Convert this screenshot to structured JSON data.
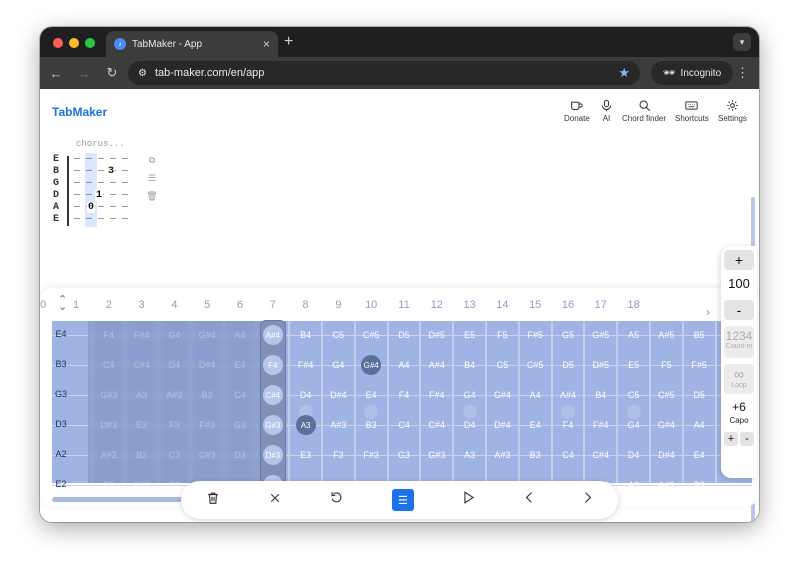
{
  "browser": {
    "tab_title": "TabMaker - App",
    "url": "tab-maker.com/en/app",
    "incognito_label": "Incognito",
    "new_tab": "+",
    "close": "×"
  },
  "header": {
    "brand": "TabMaker",
    "buttons": [
      {
        "label": "Donate",
        "icon": "coffee-icon"
      },
      {
        "label": "AI",
        "icon": "microphone-icon"
      },
      {
        "label": "Chord finder",
        "icon": "search-icon"
      },
      {
        "label": "Shortcuts",
        "icon": "keyboard-icon"
      },
      {
        "label": "Settings",
        "icon": "gear-icon"
      }
    ]
  },
  "tab_sheet": {
    "section_label": "chorus...",
    "strings": [
      "E",
      "B",
      "G",
      "D",
      "A",
      "E"
    ],
    "lines": [
      "— — — — —",
      "— — — — —",
      "— — — — —",
      "— — — — —",
      "— — — — —",
      "— — — — —"
    ],
    "notes": [
      {
        "string": 1,
        "text": "3"
      },
      {
        "string": 3,
        "text": "1"
      },
      {
        "string": 4,
        "text": "0"
      }
    ]
  },
  "fretboard": {
    "fret_numbers": [
      "0",
      "1",
      "2",
      "3",
      "4",
      "5",
      "6",
      "7",
      "8",
      "9",
      "10",
      "11",
      "12",
      "13",
      "14",
      "15",
      "16",
      "17",
      "18"
    ],
    "string_labels": [
      "E4",
      "B3",
      "G3",
      "D3",
      "A2",
      "E2"
    ],
    "notes": [
      [
        "E4",
        "F4",
        "F#4",
        "G4",
        "G#4",
        "A4",
        "A#4",
        "B4",
        "C5",
        "C#5",
        "D5",
        "D#5",
        "E5",
        "F5",
        "F#5",
        "G5",
        "G#5",
        "A5",
        "A#5",
        "B5"
      ],
      [
        "B3",
        "C4",
        "C#4",
        "D4",
        "D#4",
        "E4",
        "F4",
        "F#4",
        "G4",
        "G#4",
        "A4",
        "A#4",
        "B4",
        "C5",
        "C#5",
        "D5",
        "D#5",
        "E5",
        "F5",
        "F#5"
      ],
      [
        "G3",
        "G#3",
        "A3",
        "A#3",
        "B3",
        "C4",
        "C#4",
        "D4",
        "D#4",
        "E4",
        "F4",
        "F#4",
        "G4",
        "G#4",
        "A4",
        "A#4",
        "B4",
        "C5",
        "C#5",
        "D5"
      ],
      [
        "D3",
        "D#3",
        "E3",
        "F3",
        "F#3",
        "G3",
        "G#3",
        "A3",
        "A#3",
        "B3",
        "C4",
        "C#4",
        "D4",
        "D#4",
        "E4",
        "F4",
        "F#4",
        "G4",
        "G#4",
        "A4"
      ],
      [
        "A2",
        "A#2",
        "B2",
        "C3",
        "C#3",
        "D3",
        "D#3",
        "E3",
        "F3",
        "F#3",
        "G3",
        "G#3",
        "A3",
        "A#3",
        "B3",
        "C4",
        "C#4",
        "D4",
        "D#4",
        "E4"
      ],
      [
        "E2",
        "F2",
        "F#2",
        "G2",
        "G#2",
        "A2",
        "A#2",
        "B2",
        "C3",
        "C#3",
        "D3",
        "D#3",
        "E3",
        "F3",
        "F#3",
        "G3",
        "G#3",
        "A3",
        "A#3",
        "B3"
      ]
    ],
    "capo_fret": 6,
    "selected": [
      {
        "string": 1,
        "fret": 9
      },
      {
        "string": 3,
        "fret": 7
      }
    ]
  },
  "side_panel": {
    "plus": "+",
    "tempo": "100",
    "minus": "-",
    "countin_number": "1234",
    "countin_label": "Count-in",
    "loop_symbol": "∞",
    "loop_label": "Loop",
    "capo_value": "+6",
    "capo_label": "Capo",
    "capo_plus": "+",
    "capo_minus": "-"
  },
  "bottom_bar": {
    "icons": [
      "trash-icon",
      "close-icon",
      "undo-icon",
      "menu-icon",
      "play-icon",
      "chevron-left-icon",
      "chevron-right-icon"
    ]
  },
  "colors": {
    "accent": "#1a73e8",
    "fretboard": "#9fb3e4",
    "browser_dark": "#1f1f1f"
  }
}
